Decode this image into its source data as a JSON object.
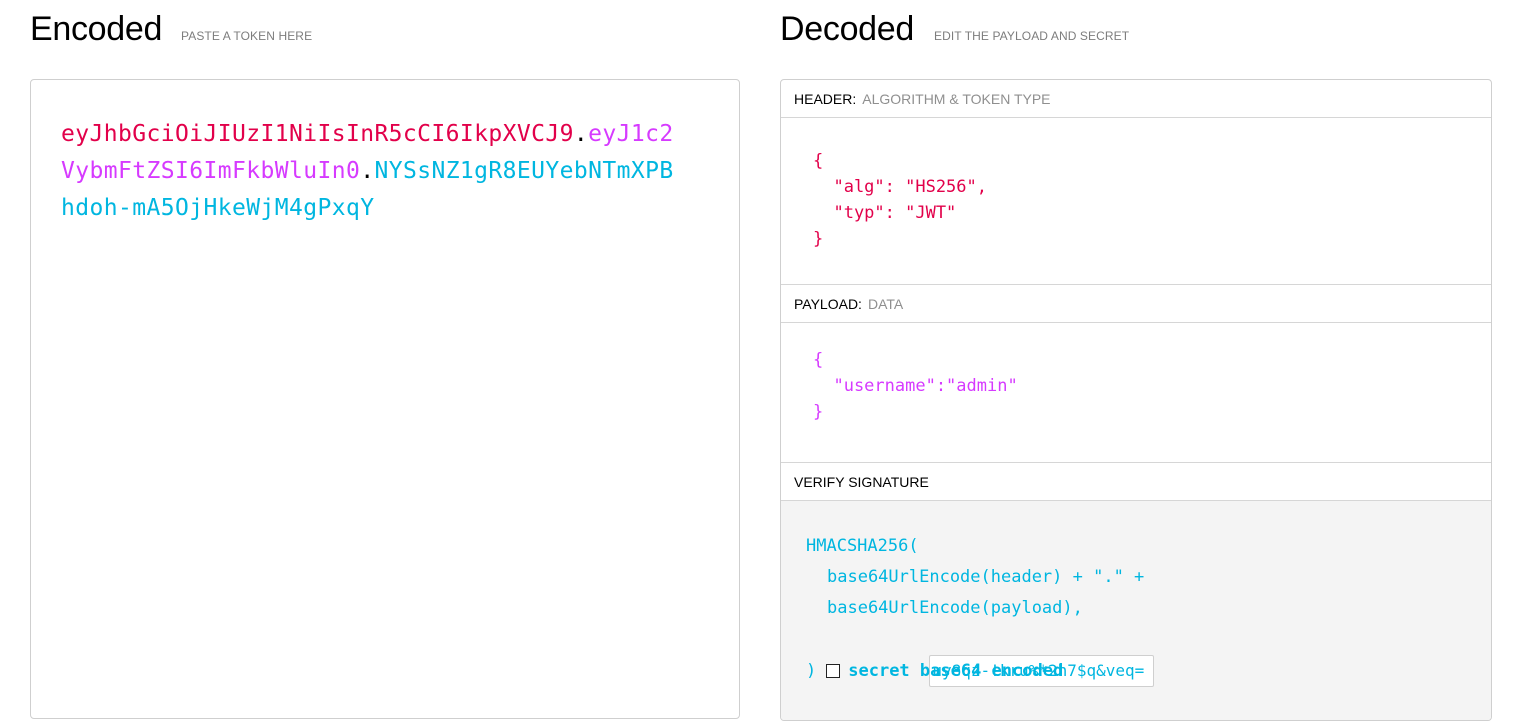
{
  "encoded": {
    "title": "Encoded",
    "subtitle": "PASTE A TOKEN HERE",
    "token_header": "eyJhbGciOiJIUzI1NiIsInR5cCI6IkpXVCJ9",
    "token_payload": "eyJ1c2VybmFtZSI6ImFkbWluIn0",
    "token_signature": "NYSsNZ1gR8EUYebNTmXPBhdoh-mA5OjHkeWjM4gPxqY",
    "separator": "."
  },
  "decoded": {
    "title": "Decoded",
    "subtitle": "EDIT THE PAYLOAD AND SECRET",
    "header_section": {
      "label": "HEADER:",
      "sublabel": "ALGORITHM & TOKEN TYPE",
      "json": "{\n  \"alg\": \"HS256\",\n  \"typ\": \"JWT\"\n}"
    },
    "payload_section": {
      "label": "PAYLOAD:",
      "sublabel": "DATA",
      "json": "{\n  \"username\":\"admin\"\n}"
    },
    "verify_section": {
      "label": "VERIFY SIGNATURE",
      "line1": "HMACSHA256(",
      "line2": "base64UrlEncode(header) + \".\" +",
      "line3": "base64UrlEncode(payload),",
      "secret_value": "uy8qz-!kru%*2h7$q&veq=",
      "close_paren": ")",
      "secret_checkbox_label": "secret base64 encoded"
    }
  },
  "colors": {
    "header": "#e2004a",
    "payload": "#d63aff",
    "signature": "#00b6e0"
  }
}
